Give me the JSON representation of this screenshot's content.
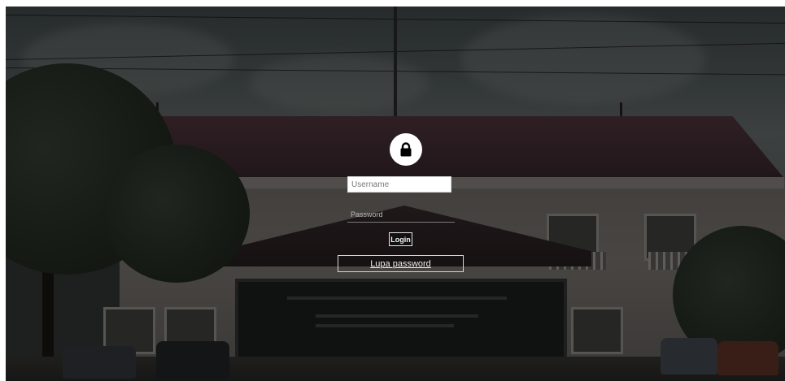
{
  "login": {
    "lock_icon": "lock-icon",
    "username_placeholder": "Username",
    "password_placeholder": "Password",
    "login_label": "Login",
    "forgot_password_label": "Lupa password"
  },
  "colors": {
    "overlay": "#000000",
    "input_background": "#ffffff",
    "button_background": "#111111",
    "text_light": "#f0f0f0"
  }
}
